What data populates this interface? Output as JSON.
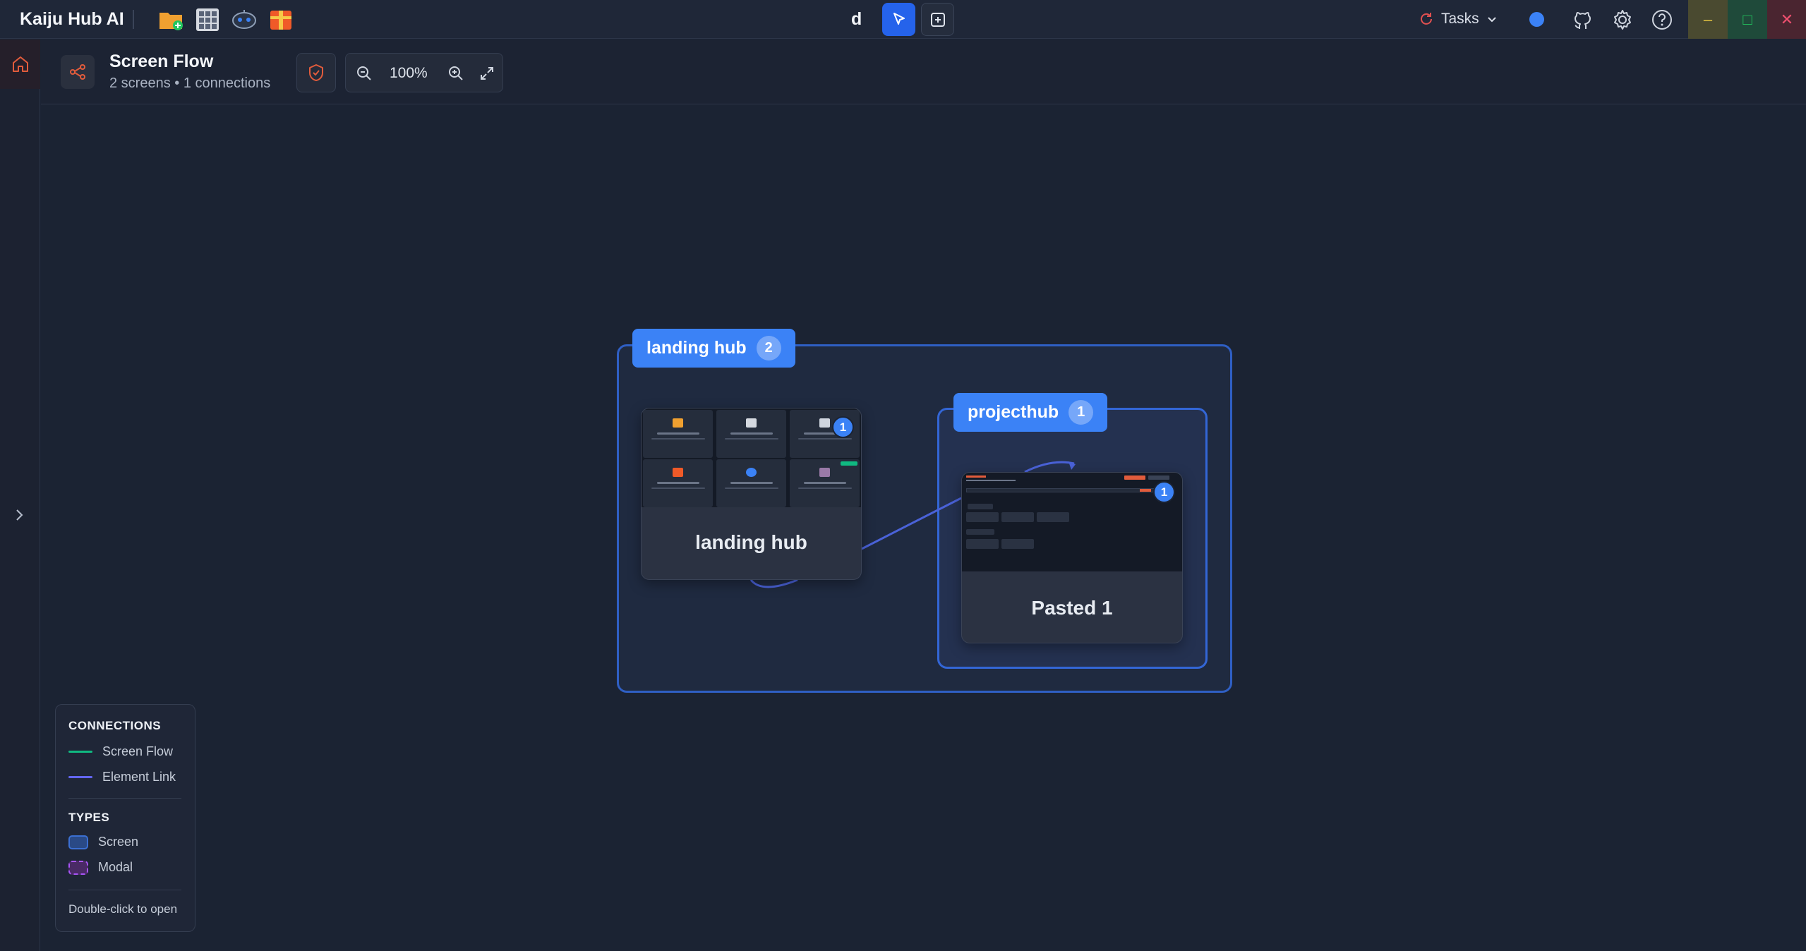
{
  "app": {
    "title": "Kaiju Hub AI",
    "center_label": "d"
  },
  "toolbar": {
    "apps": [
      {
        "name": "folder-add-icon",
        "color": "#f0a030"
      },
      {
        "name": "grid-app-icon",
        "color": "#9aa4b5"
      },
      {
        "name": "robot-app-icon",
        "color": "#3b82f6"
      },
      {
        "name": "package-app-icon",
        "color": "#f05a28"
      }
    ],
    "tasks_label": "Tasks"
  },
  "subheader": {
    "title": "Screen Flow",
    "subtitle": "2 screens • 1 connections",
    "zoom": "100%"
  },
  "canvas": {
    "groups": [
      {
        "label": "landing hub",
        "count": "2"
      },
      {
        "label": "projecthub",
        "count": "1"
      }
    ],
    "screens": [
      {
        "title": "landing hub",
        "badge": "1"
      },
      {
        "title": "Pasted 1",
        "badge": "1"
      }
    ]
  },
  "legend": {
    "connections_heading": "CONNECTIONS",
    "screen_flow": "Screen Flow",
    "element_link": "Element Link",
    "types_heading": "TYPES",
    "screen": "Screen",
    "modal": "Modal",
    "hint": "Double-click to open"
  },
  "colors": {
    "accent": "#3b82f6",
    "screen_flow": "#10b981",
    "element_link": "#6366f1",
    "screen_type": "#3b6fd1",
    "modal_type": "#a855f7"
  }
}
